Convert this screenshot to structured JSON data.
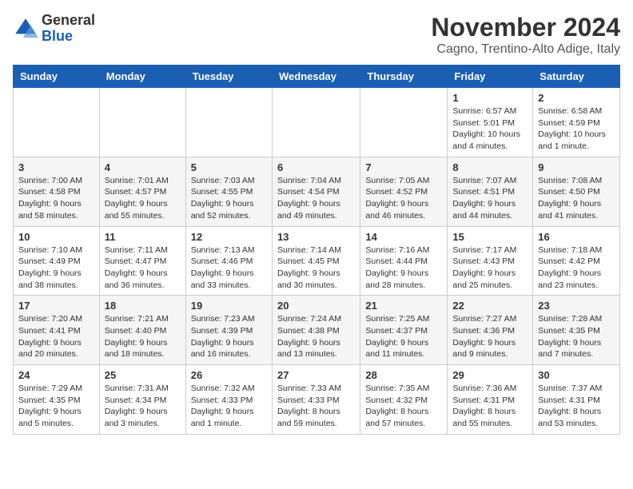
{
  "header": {
    "logo_general": "General",
    "logo_blue": "Blue",
    "month_year": "November 2024",
    "location": "Cagno, Trentino-Alto Adige, Italy"
  },
  "weekdays": [
    "Sunday",
    "Monday",
    "Tuesday",
    "Wednesday",
    "Thursday",
    "Friday",
    "Saturday"
  ],
  "weeks": [
    [
      {
        "day": "",
        "info": ""
      },
      {
        "day": "",
        "info": ""
      },
      {
        "day": "",
        "info": ""
      },
      {
        "day": "",
        "info": ""
      },
      {
        "day": "",
        "info": ""
      },
      {
        "day": "1",
        "info": "Sunrise: 6:57 AM\nSunset: 5:01 PM\nDaylight: 10 hours and 4 minutes."
      },
      {
        "day": "2",
        "info": "Sunrise: 6:58 AM\nSunset: 4:59 PM\nDaylight: 10 hours and 1 minute."
      }
    ],
    [
      {
        "day": "3",
        "info": "Sunrise: 7:00 AM\nSunset: 4:58 PM\nDaylight: 9 hours and 58 minutes."
      },
      {
        "day": "4",
        "info": "Sunrise: 7:01 AM\nSunset: 4:57 PM\nDaylight: 9 hours and 55 minutes."
      },
      {
        "day": "5",
        "info": "Sunrise: 7:03 AM\nSunset: 4:55 PM\nDaylight: 9 hours and 52 minutes."
      },
      {
        "day": "6",
        "info": "Sunrise: 7:04 AM\nSunset: 4:54 PM\nDaylight: 9 hours and 49 minutes."
      },
      {
        "day": "7",
        "info": "Sunrise: 7:05 AM\nSunset: 4:52 PM\nDaylight: 9 hours and 46 minutes."
      },
      {
        "day": "8",
        "info": "Sunrise: 7:07 AM\nSunset: 4:51 PM\nDaylight: 9 hours and 44 minutes."
      },
      {
        "day": "9",
        "info": "Sunrise: 7:08 AM\nSunset: 4:50 PM\nDaylight: 9 hours and 41 minutes."
      }
    ],
    [
      {
        "day": "10",
        "info": "Sunrise: 7:10 AM\nSunset: 4:49 PM\nDaylight: 9 hours and 38 minutes."
      },
      {
        "day": "11",
        "info": "Sunrise: 7:11 AM\nSunset: 4:47 PM\nDaylight: 9 hours and 36 minutes."
      },
      {
        "day": "12",
        "info": "Sunrise: 7:13 AM\nSunset: 4:46 PM\nDaylight: 9 hours and 33 minutes."
      },
      {
        "day": "13",
        "info": "Sunrise: 7:14 AM\nSunset: 4:45 PM\nDaylight: 9 hours and 30 minutes."
      },
      {
        "day": "14",
        "info": "Sunrise: 7:16 AM\nSunset: 4:44 PM\nDaylight: 9 hours and 28 minutes."
      },
      {
        "day": "15",
        "info": "Sunrise: 7:17 AM\nSunset: 4:43 PM\nDaylight: 9 hours and 25 minutes."
      },
      {
        "day": "16",
        "info": "Sunrise: 7:18 AM\nSunset: 4:42 PM\nDaylight: 9 hours and 23 minutes."
      }
    ],
    [
      {
        "day": "17",
        "info": "Sunrise: 7:20 AM\nSunset: 4:41 PM\nDaylight: 9 hours and 20 minutes."
      },
      {
        "day": "18",
        "info": "Sunrise: 7:21 AM\nSunset: 4:40 PM\nDaylight: 9 hours and 18 minutes."
      },
      {
        "day": "19",
        "info": "Sunrise: 7:23 AM\nSunset: 4:39 PM\nDaylight: 9 hours and 16 minutes."
      },
      {
        "day": "20",
        "info": "Sunrise: 7:24 AM\nSunset: 4:38 PM\nDaylight: 9 hours and 13 minutes."
      },
      {
        "day": "21",
        "info": "Sunrise: 7:25 AM\nSunset: 4:37 PM\nDaylight: 9 hours and 11 minutes."
      },
      {
        "day": "22",
        "info": "Sunrise: 7:27 AM\nSunset: 4:36 PM\nDaylight: 9 hours and 9 minutes."
      },
      {
        "day": "23",
        "info": "Sunrise: 7:28 AM\nSunset: 4:35 PM\nDaylight: 9 hours and 7 minutes."
      }
    ],
    [
      {
        "day": "24",
        "info": "Sunrise: 7:29 AM\nSunset: 4:35 PM\nDaylight: 9 hours and 5 minutes."
      },
      {
        "day": "25",
        "info": "Sunrise: 7:31 AM\nSunset: 4:34 PM\nDaylight: 9 hours and 3 minutes."
      },
      {
        "day": "26",
        "info": "Sunrise: 7:32 AM\nSunset: 4:33 PM\nDaylight: 9 hours and 1 minute."
      },
      {
        "day": "27",
        "info": "Sunrise: 7:33 AM\nSunset: 4:33 PM\nDaylight: 8 hours and 59 minutes."
      },
      {
        "day": "28",
        "info": "Sunrise: 7:35 AM\nSunset: 4:32 PM\nDaylight: 8 hours and 57 minutes."
      },
      {
        "day": "29",
        "info": "Sunrise: 7:36 AM\nSunset: 4:31 PM\nDaylight: 8 hours and 55 minutes."
      },
      {
        "day": "30",
        "info": "Sunrise: 7:37 AM\nSunset: 4:31 PM\nDaylight: 8 hours and 53 minutes."
      }
    ]
  ]
}
